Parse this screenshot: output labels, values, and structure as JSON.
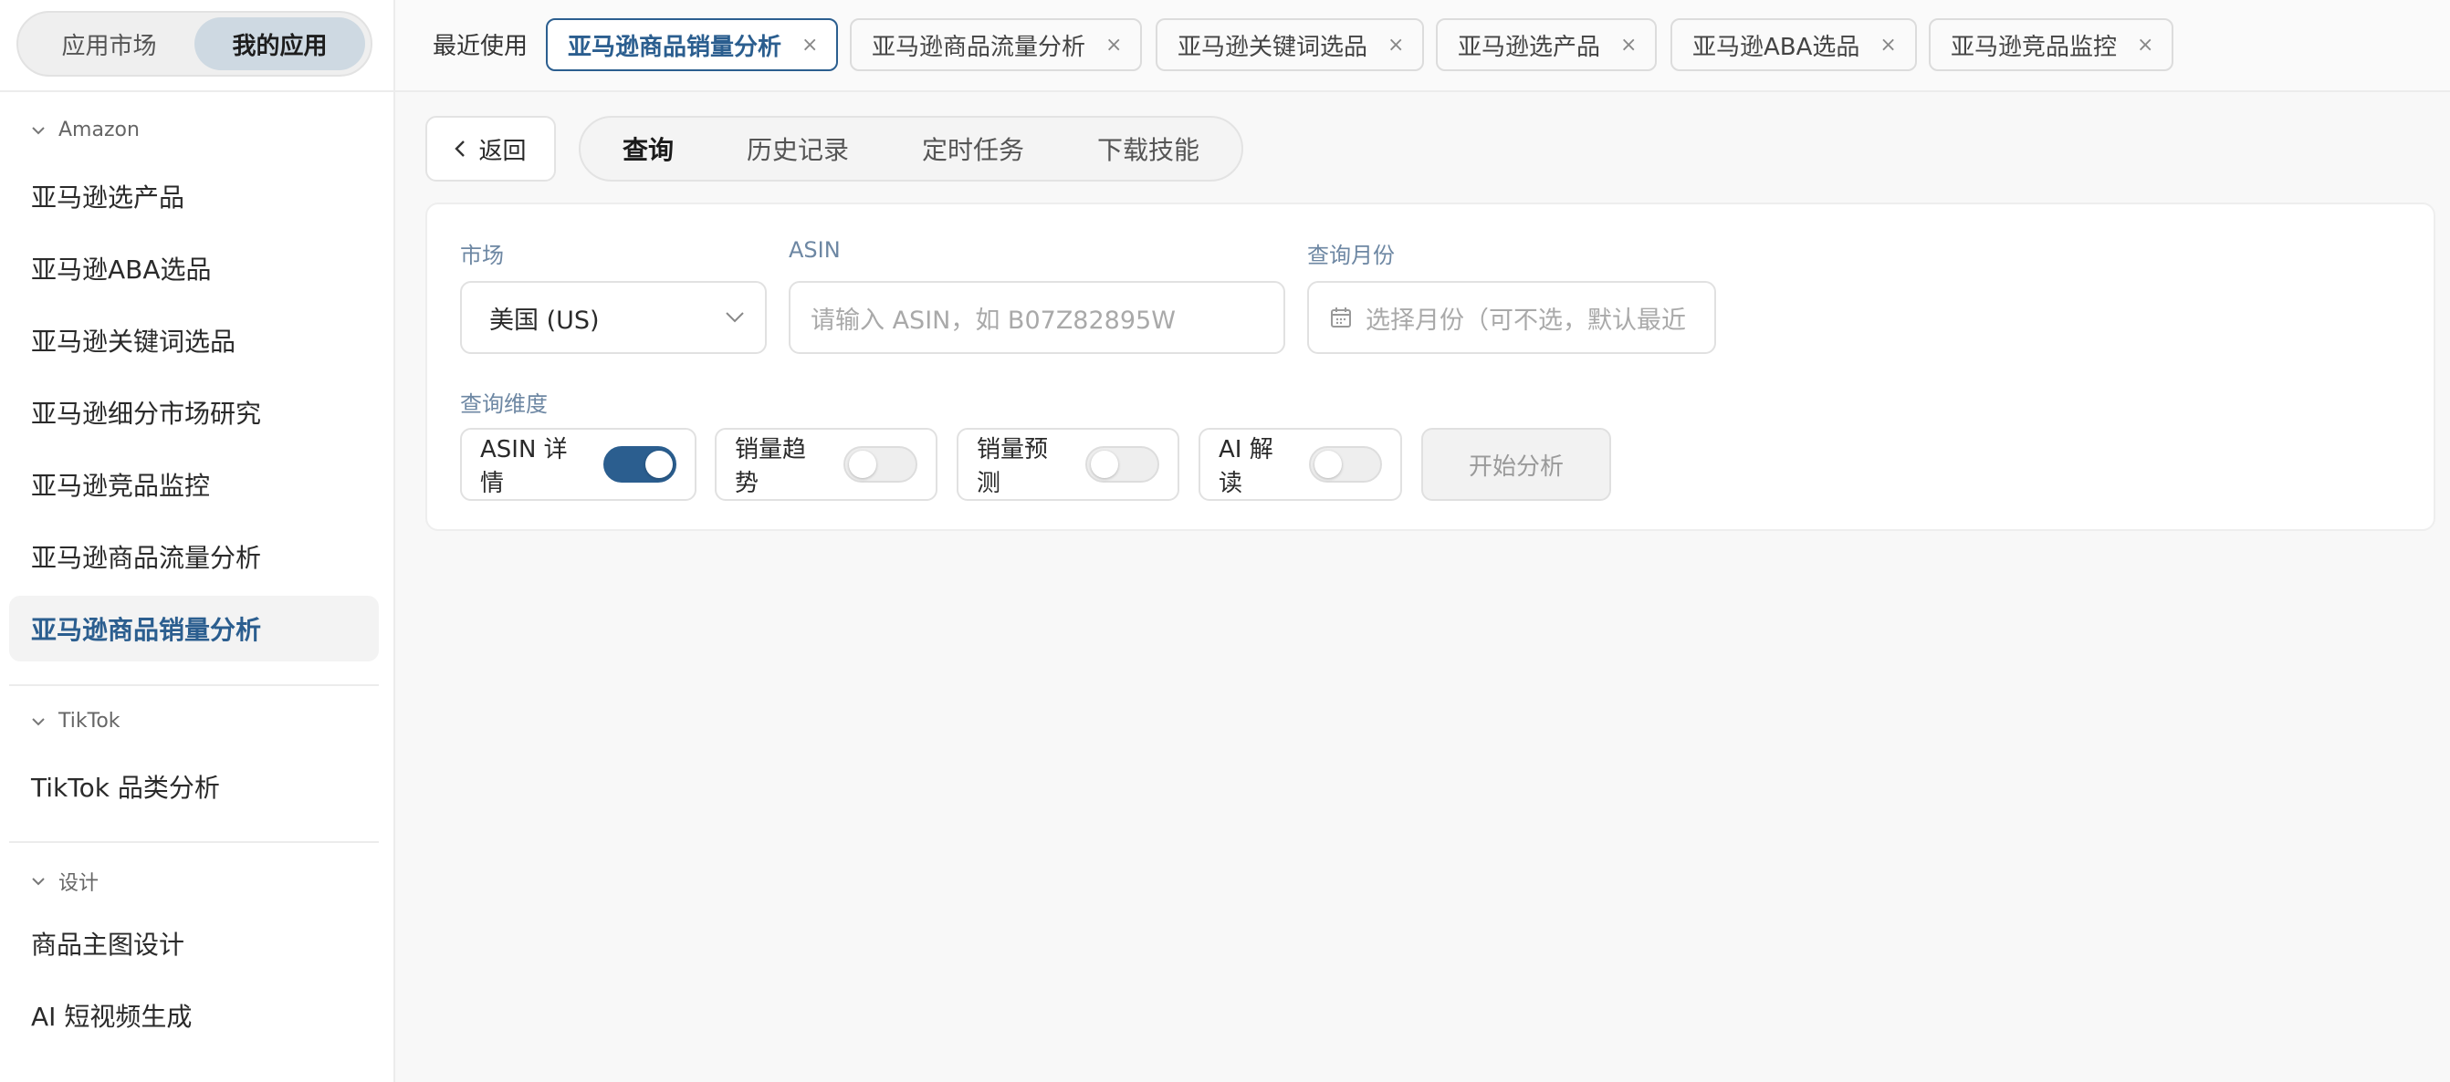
{
  "sidebar": {
    "segment": {
      "market": "应用市场",
      "mine": "我的应用"
    },
    "groups": [
      {
        "title": "Amazon",
        "items": [
          "亚马逊选产品",
          "亚马逊ABA选品",
          "亚马逊关键词选品",
          "亚马逊细分市场研究",
          "亚马逊竞品监控",
          "亚马逊商品流量分析",
          "亚马逊商品销量分析"
        ]
      },
      {
        "title": "TikTok",
        "items": [
          "TikTok 品类分析"
        ]
      },
      {
        "title": "设计",
        "items": [
          "商品主图设计",
          "AI 短视频生成"
        ]
      }
    ],
    "active_item": "亚马逊商品销量分析"
  },
  "topbar": {
    "recent_label": "最近使用",
    "tabs": [
      "亚马逊商品销量分析",
      "亚马逊商品流量分析",
      "亚马逊关键词选品",
      "亚马逊选产品",
      "亚马逊ABA选品",
      "亚马逊竞品监控"
    ],
    "close_glyph": "×"
  },
  "main": {
    "back_label": "返回",
    "tabs": [
      "查询",
      "历史记录",
      "定时任务",
      "下载技能"
    ],
    "active_tab": "查询"
  },
  "form": {
    "market_label": "市场",
    "market_value": "美国 (US)",
    "asin_label": "ASIN",
    "asin_placeholder": "请输入 ASIN，如 B07Z82895W",
    "month_label": "查询月份",
    "month_placeholder": "选择月份（可不选，默认最近",
    "dimension_label": "查询维度",
    "toggles": [
      {
        "label": "ASIN 详情",
        "on": true
      },
      {
        "label": "销量趋势",
        "on": false
      },
      {
        "label": "销量预测",
        "on": false
      },
      {
        "label": "AI 解读",
        "on": false
      }
    ],
    "start_label": "开始分析"
  },
  "colors": {
    "accent": "#2b5e8f",
    "label": "#6d87a3",
    "segment_active": "#ced9e2"
  },
  "icons": [
    "chevron-down-icon",
    "chevron-left-icon",
    "calendar-icon",
    "close-icon"
  ]
}
